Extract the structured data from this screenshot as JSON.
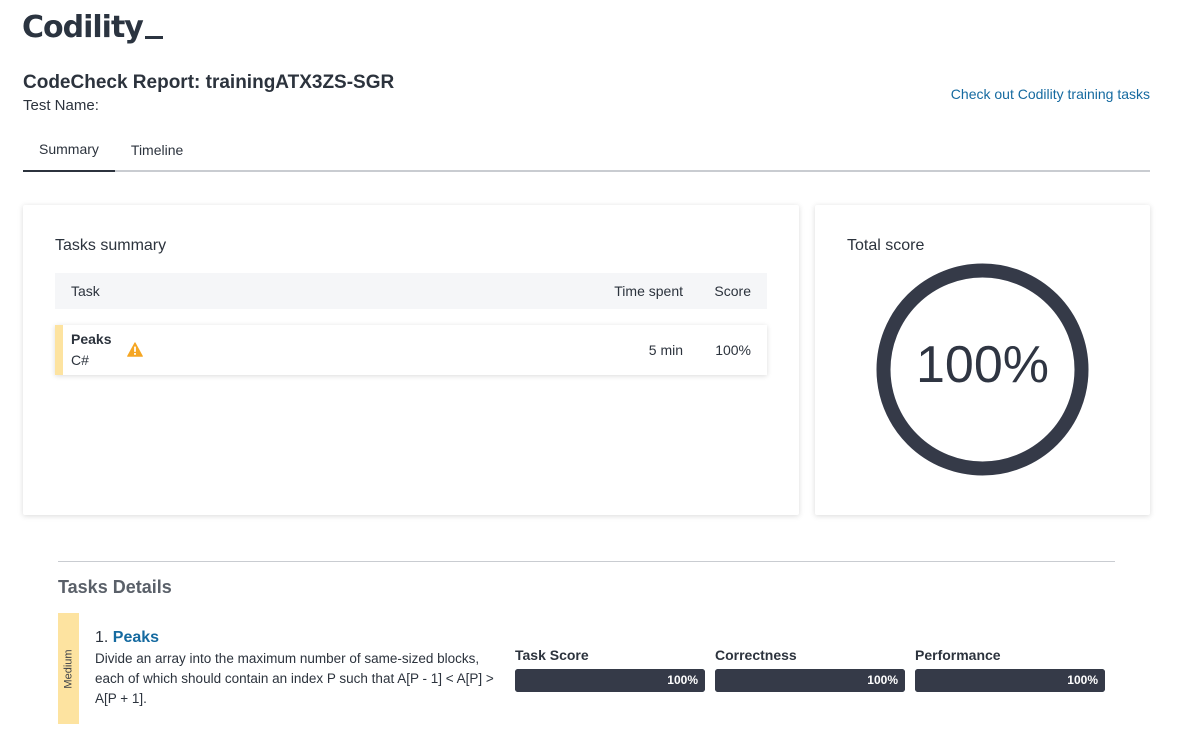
{
  "brand": {
    "logo_text": "Codility"
  },
  "report": {
    "title": "CodeCheck Report: trainingATX3ZS-SGR",
    "test_name_label": "Test Name:",
    "training_link": "Check out Codility training tasks"
  },
  "tabs": [
    {
      "label": "Summary",
      "active": true
    },
    {
      "label": "Timeline",
      "active": false
    }
  ],
  "tasks_summary": {
    "title": "Tasks summary",
    "columns": {
      "task": "Task",
      "time": "Time spent",
      "score": "Score"
    },
    "rows": [
      {
        "name": "Peaks",
        "language": "C#",
        "time": "5 min",
        "score": "100%",
        "warning_icon": "warning-triangle-icon"
      }
    ]
  },
  "total_score": {
    "title": "Total score",
    "value": "100%",
    "fraction": 1.0
  },
  "tasks_details": {
    "title": "Tasks Details",
    "tasks": [
      {
        "difficulty": "Medium",
        "number": "1.",
        "name": "Peaks",
        "description": "Divide an array into the maximum number of same-sized blocks, each of which should contain an index P such that A[P - 1] < A[P] > A[P + 1].",
        "metrics": [
          {
            "label": "Task Score",
            "value": "100%",
            "fraction": 1.0
          },
          {
            "label": "Correctness",
            "value": "100%",
            "fraction": 1.0
          },
          {
            "label": "Performance",
            "value": "100%",
            "fraction": 1.0
          }
        ]
      }
    ]
  },
  "colors": {
    "accent_link": "#156aa0",
    "dark": "#353a48",
    "medium_badge": "#fde3a0",
    "warning": "#f5a623"
  }
}
